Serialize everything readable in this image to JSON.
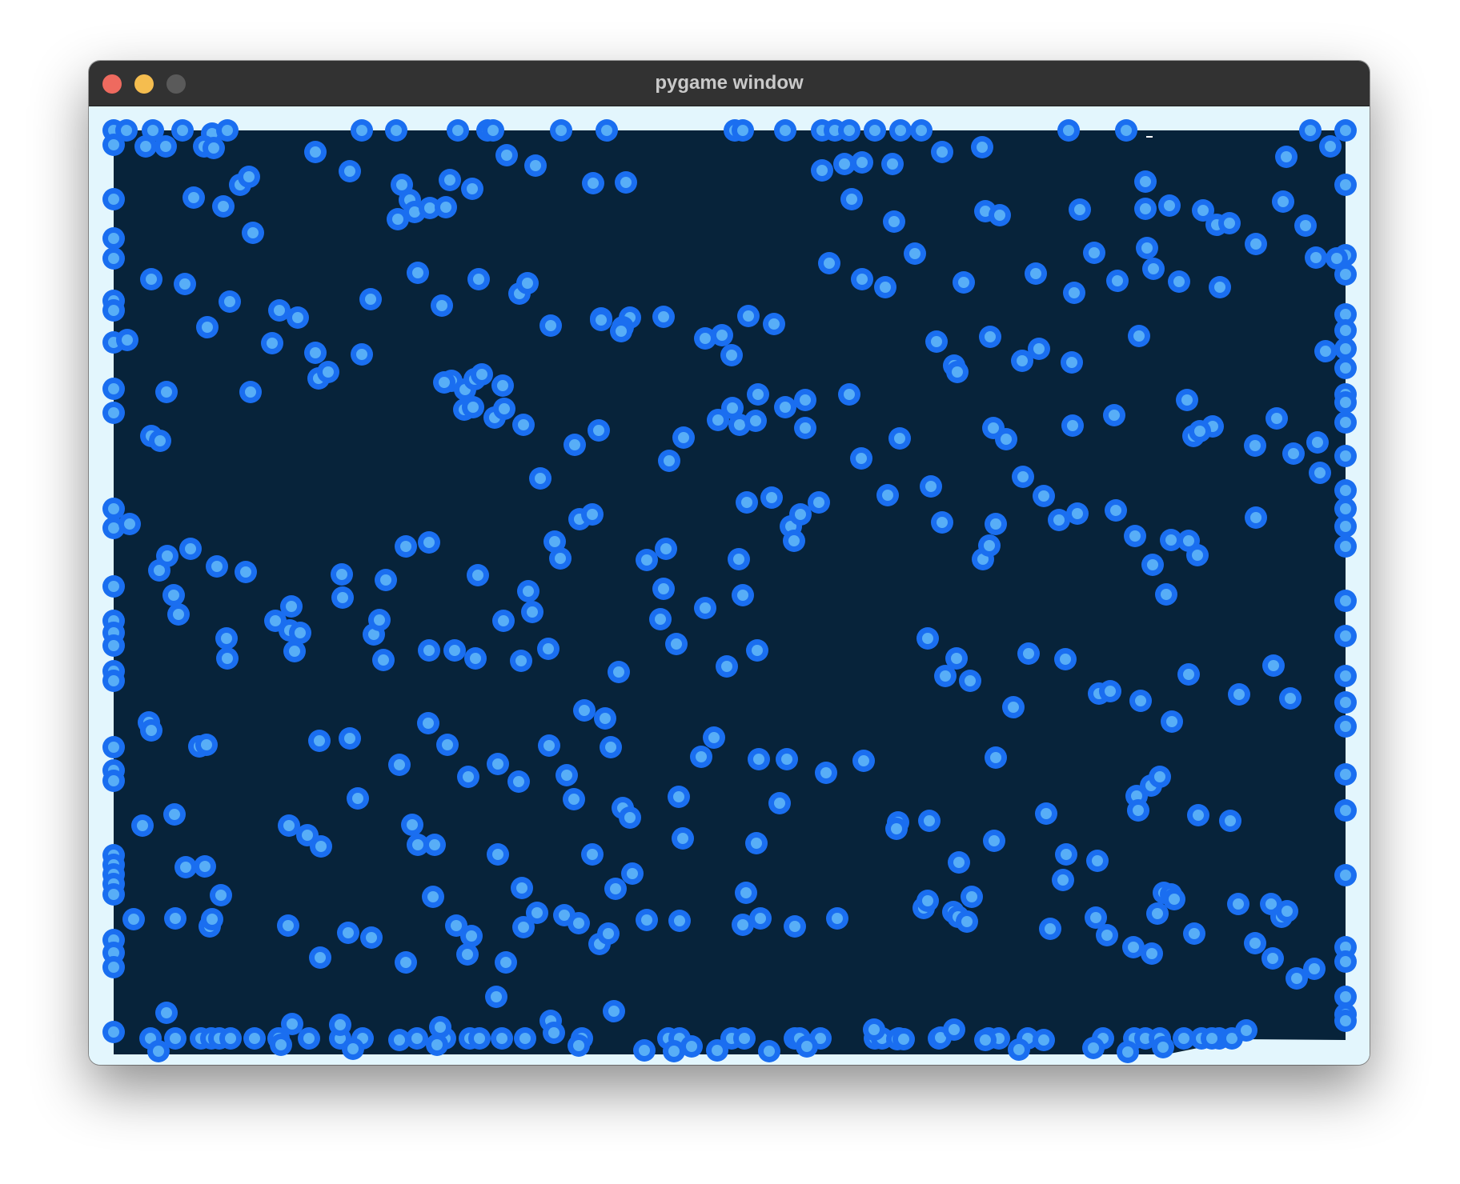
{
  "window": {
    "title": "pygame window",
    "controls": [
      "close-icon",
      "minimize-icon",
      "zoom-icon"
    ]
  },
  "colors": {
    "background": "#e3f6fd",
    "arena": "#07233a",
    "ball_outer": "#1a6ef0",
    "ball_inner": "#58aef7",
    "titlebar": "#323232",
    "close": "#ee6a5f",
    "minimize": "#f5bd4f",
    "zoom": "#5a5a5a"
  }
}
